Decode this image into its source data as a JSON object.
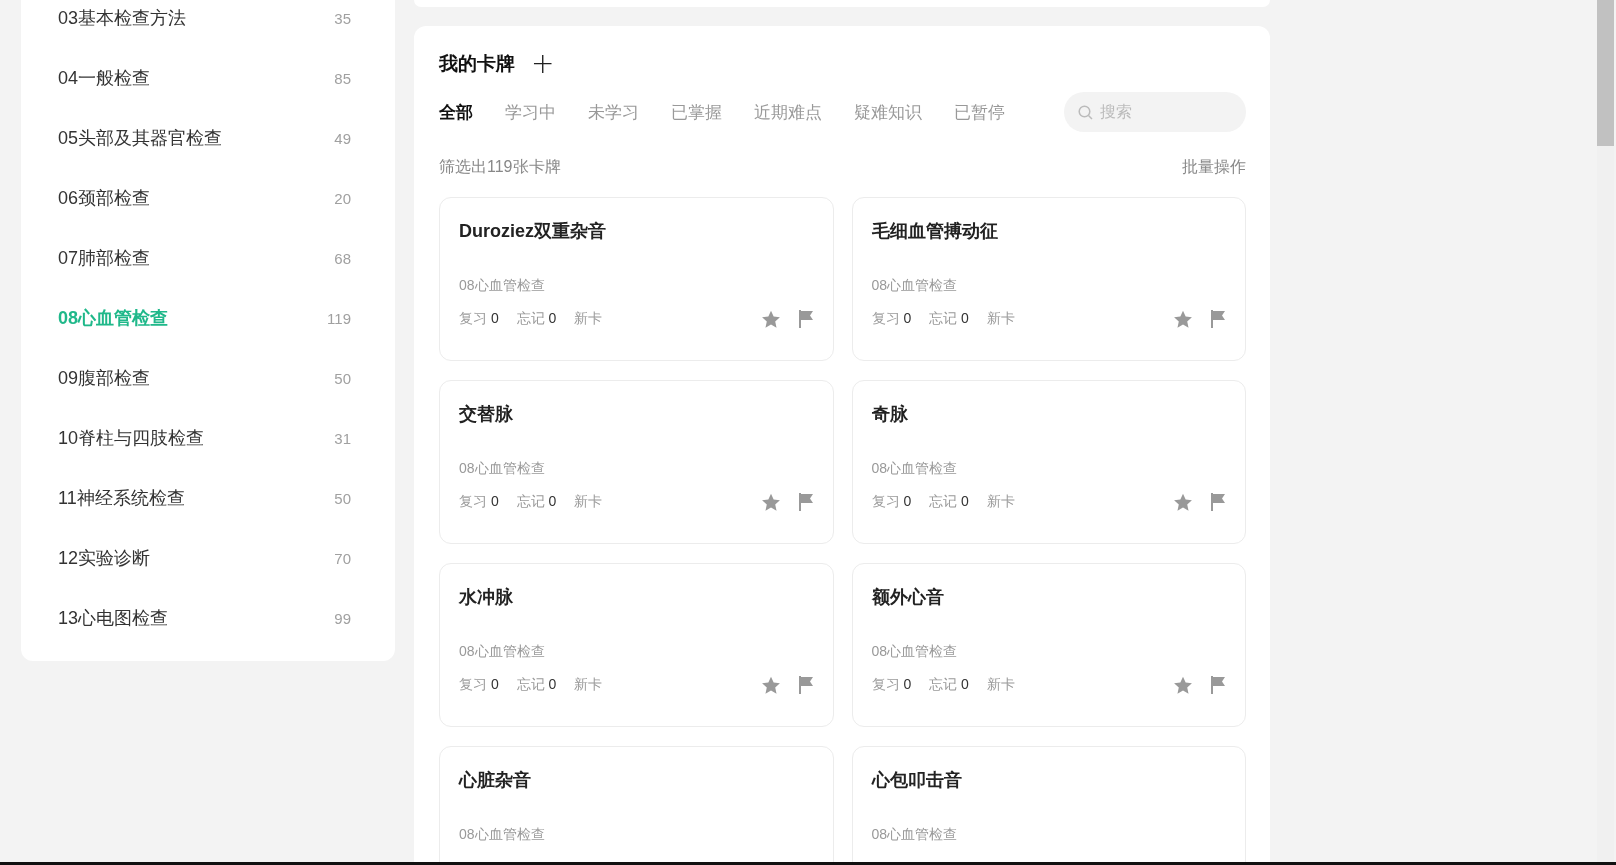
{
  "sidebar": {
    "items": [
      {
        "label": "03基本检查方法",
        "count": "35",
        "selected": false
      },
      {
        "label": "04一般检查",
        "count": "85",
        "selected": false
      },
      {
        "label": "05头部及其器官检查",
        "count": "49",
        "selected": false
      },
      {
        "label": "06颈部检查",
        "count": "20",
        "selected": false
      },
      {
        "label": "07肺部检查",
        "count": "68",
        "selected": false
      },
      {
        "label": "08心血管检查",
        "count": "119",
        "selected": true
      },
      {
        "label": "09腹部检查",
        "count": "50",
        "selected": false
      },
      {
        "label": "10脊柱与四肢检查",
        "count": "31",
        "selected": false
      },
      {
        "label": "11神经系统检查",
        "count": "50",
        "selected": false
      },
      {
        "label": "12实验诊断",
        "count": "70",
        "selected": false
      },
      {
        "label": "13心电图检查",
        "count": "99",
        "selected": false
      }
    ]
  },
  "cards_panel": {
    "title": "我的卡牌",
    "add_button": "+",
    "tabs": [
      {
        "label": "全部",
        "selected": true
      },
      {
        "label": "学习中",
        "selected": false
      },
      {
        "label": "未学习",
        "selected": false
      },
      {
        "label": "已掌握",
        "selected": false
      },
      {
        "label": "近期难点",
        "selected": false
      },
      {
        "label": "疑难知识",
        "selected": false
      },
      {
        "label": "已暂停",
        "selected": false
      }
    ],
    "search": {
      "placeholder": "搜索"
    },
    "filter_summary": "筛选出119张卡牌",
    "batch_action": "批量操作",
    "cards": [
      {
        "title": "Duroziez双重杂音",
        "category": "08心血管检查",
        "stats": {
          "review_label": "复习",
          "review": "0",
          "forget_label": "忘记",
          "forget": "0",
          "status": "新卡"
        },
        "starred": false,
        "flagged": false
      },
      {
        "title": "毛细血管搏动征",
        "category": "08心血管检查",
        "stats": {
          "review_label": "复习",
          "review": "0",
          "forget_label": "忘记",
          "forget": "0",
          "status": "新卡"
        },
        "starred": false,
        "flagged": false
      },
      {
        "title": "交替脉",
        "category": "08心血管检查",
        "stats": {
          "review_label": "复习",
          "review": "0",
          "forget_label": "忘记",
          "forget": "0",
          "status": "新卡"
        },
        "starred": false,
        "flagged": false
      },
      {
        "title": "奇脉",
        "category": "08心血管检查",
        "stats": {
          "review_label": "复习",
          "review": "0",
          "forget_label": "忘记",
          "forget": "0",
          "status": "新卡"
        },
        "starred": false,
        "flagged": false
      },
      {
        "title": "水冲脉",
        "category": "08心血管检查",
        "stats": {
          "review_label": "复习",
          "review": "0",
          "forget_label": "忘记",
          "forget": "0",
          "status": "新卡"
        },
        "starred": false,
        "flagged": false
      },
      {
        "title": "额外心音",
        "category": "08心血管检查",
        "stats": {
          "review_label": "复习",
          "review": "0",
          "forget_label": "忘记",
          "forget": "0",
          "status": "新卡"
        },
        "starred": false,
        "flagged": false
      },
      {
        "title": "心脏杂音",
        "category": "08心血管检查"
      },
      {
        "title": "心包叩击音",
        "category": "08心血管检查"
      }
    ]
  }
}
